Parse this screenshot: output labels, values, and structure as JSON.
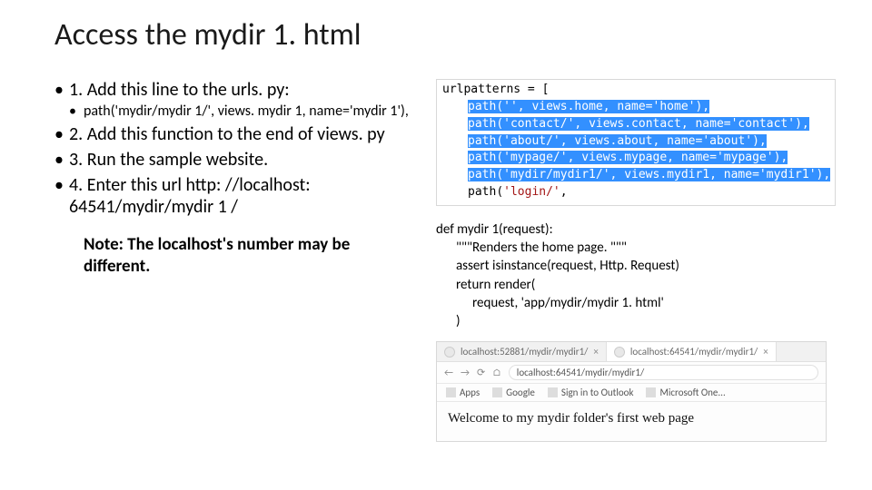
{
  "slide": {
    "title": "Access the mydir 1. html",
    "bullets": {
      "b1": "1. Add this line to the urls. py:",
      "b1a": "path('mydir/mydir 1/', views. mydir 1, name='mydir 1'),",
      "b2": "2. Add this function to the end of views. py",
      "b3": "3. Run the sample website.",
      "b4": "4. Enter this url http: //localhost: 64541/mydir/mydir 1 /"
    },
    "note": "Note: The localhost's number may be different."
  },
  "code": {
    "urlpatterns_header": "urlpatterns = [",
    "lines": [
      "path('', views.home, name='home'),",
      "path('contact/', views.contact, name='contact'),",
      "path('about/', views.about, name='about'),",
      "path('mypage/', views.mypage, name='mypage'),",
      "path('mydir/mydir1/', views.mydir1, name='mydir1'),"
    ],
    "line_unsel": "path('login/',",
    "path_kw": "path",
    "comma": ",",
    "open_paren": "(",
    "close_paren": ")",
    "strings": {
      "s0a": "''",
      "s0b": "'home'",
      "s1a": "'contact/'",
      "s1b": "'contact'",
      "s2a": "'about/'",
      "s2b": "'about'",
      "s3a": "'mypage/'",
      "s3b": "'mypage'",
      "s4a": "'mydir/mydir1/'",
      "s4b": "'mydir1'",
      "s5a": "'login/'"
    },
    "mids": {
      "m0": ", views.home, name=",
      "m1": ", views.contact, name=",
      "m2": ", views.about, name=",
      "m3": ", views.mypage, name=",
      "m4": ", views.mydir1, name="
    },
    "tail": "),"
  },
  "fn": {
    "l0": "def mydir 1(request):",
    "l1": "\"\"\"Renders the home page. \"\"\"",
    "l2": "assert isinstance(request, Http. Request)",
    "l3": "return render(",
    "l4": "request, 'app/mydir/mydir 1. html'",
    "l5": ")"
  },
  "browser": {
    "tab1": "localhost:52881/mydir/mydir1/",
    "tab2": "localhost:64541/mydir/mydir1/",
    "address": "localhost:64541/mydir/mydir1/",
    "bookmarks": {
      "apps": "Apps",
      "google": "Google",
      "signin": "Sign in to Outlook",
      "msone": "Microsoft One..."
    },
    "heading": "Welcome to my mydir folder's first web page",
    "nav": {
      "back": "←",
      "fwd": "→",
      "reload": "⟳",
      "home": "⌂"
    },
    "close": "×"
  }
}
